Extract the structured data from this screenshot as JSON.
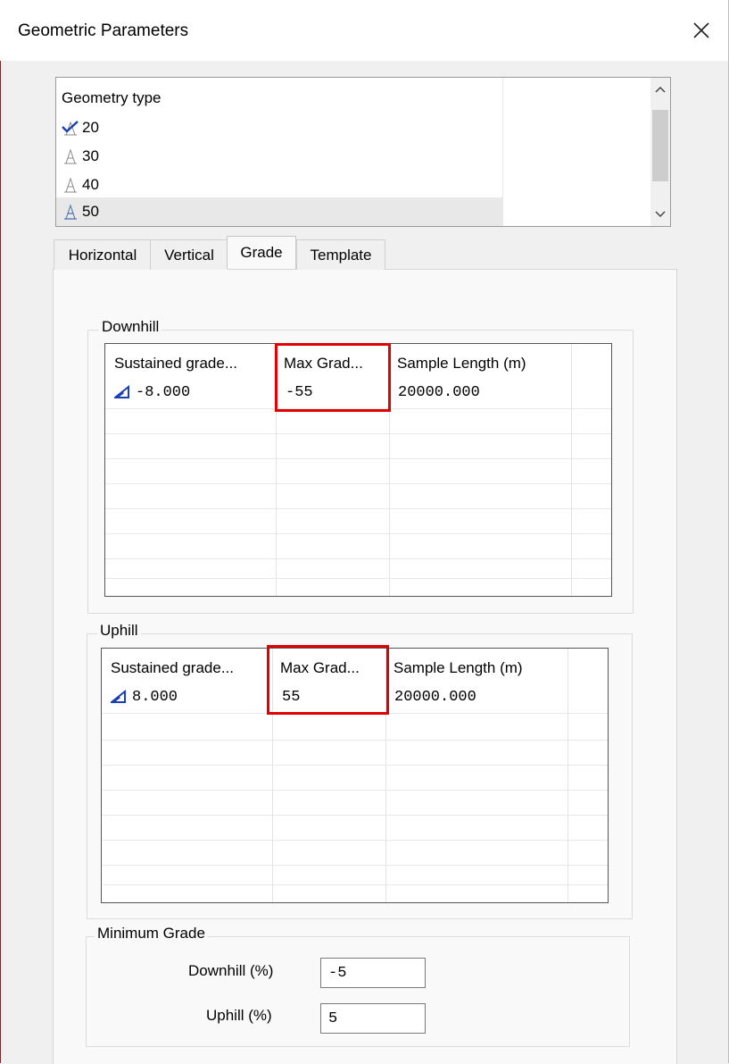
{
  "window": {
    "title": "Geometric Parameters"
  },
  "geometry_list": {
    "header": "Geometry type",
    "items": [
      {
        "label": "20",
        "icon": "checked-geometry-icon",
        "selected": false
      },
      {
        "label": "30",
        "icon": "geometry-icon",
        "selected": false
      },
      {
        "label": "40",
        "icon": "geometry-icon",
        "selected": false
      },
      {
        "label": "50",
        "icon": "geometry-icon",
        "selected": true
      }
    ]
  },
  "tabs": [
    {
      "label": "Horizontal",
      "active": false
    },
    {
      "label": "Vertical",
      "active": false
    },
    {
      "label": "Grade",
      "active": true
    },
    {
      "label": "Template",
      "active": false
    }
  ],
  "downhill": {
    "group_label": "Downhill",
    "columns": [
      "Sustained grade...",
      "Max Grad...",
      "Sample Length (m)"
    ],
    "rows": [
      {
        "sustained": "-8.000",
        "max_grade": "-55",
        "sample_length": "20000.000"
      }
    ]
  },
  "uphill": {
    "group_label": "Uphill",
    "columns": [
      "Sustained grade...",
      "Max Grad...",
      "Sample Length (m)"
    ],
    "rows": [
      {
        "sustained": "8.000",
        "max_grade": "55",
        "sample_length": "20000.000"
      }
    ]
  },
  "minimum_grade": {
    "group_label": "Minimum Grade",
    "downhill_label": "Downhill (%)",
    "downhill_value": "-5",
    "uphill_label": "Uphill (%)",
    "uphill_value": "5"
  },
  "colors": {
    "highlight": "#e00000",
    "accent_icon": "#1a3fb0"
  }
}
